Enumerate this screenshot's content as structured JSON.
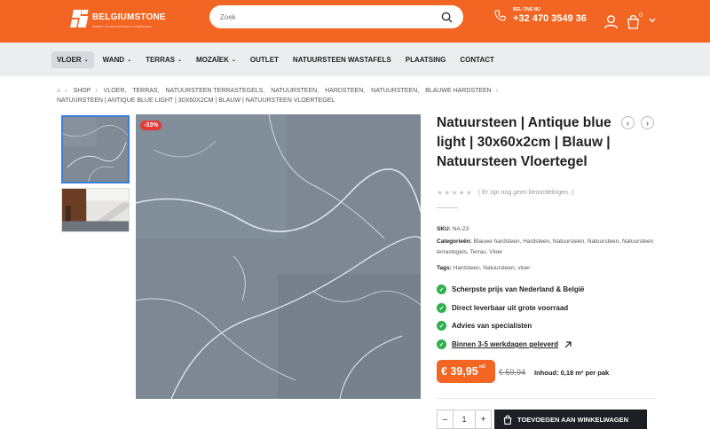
{
  "header": {
    "logo_name": "BELGIUMSTONE",
    "logo_tagline": "EXPERTS IN NATUURSTEEN & VLOERTEGELS",
    "search_placeholder": "Zoek",
    "call_label": "BEL ONS NU",
    "phone": "+32 470 3549 36",
    "cart_count": "0",
    "brand_color": "#f26522"
  },
  "nav": {
    "items": [
      {
        "label": "VLOER",
        "dropdown": true
      },
      {
        "label": "WAND",
        "dropdown": true
      },
      {
        "label": "TERRAS",
        "dropdown": true
      },
      {
        "label": "MOZAÏEK",
        "dropdown": true
      },
      {
        "label": "OUTLET",
        "dropdown": false
      },
      {
        "label": "NATUURSTEEN WASTAFELS",
        "dropdown": false
      },
      {
        "label": "PLAATSING",
        "dropdown": false
      },
      {
        "label": "CONTACT",
        "dropdown": false
      }
    ]
  },
  "breadcrumb": {
    "items": [
      "SHOP",
      "VLOER,",
      "TERRAS,",
      "NATUURSTEEN TERRASTEGELS,",
      "NATUURSTEEN,",
      "HARDSTEEN,",
      "NATUURSTEEN,",
      "BLAUWE HARDSTEEN"
    ],
    "current": "NATUURSTEEN | ANTIQUE BLUE LIGHT | 30X60X2CM | BLAUW | NATUURSTEEN VLOERTEGEL"
  },
  "product": {
    "discount_badge": "-33%",
    "title": "Natuursteen | Antique blue light | 30x60x2cm | Blauw | Natuursteen Vloertegel",
    "rating_text": "( Er zijn nog geen beoordelingen. )",
    "sku_label": "SKU:",
    "sku": "NA-23",
    "categories_label": "Categorieën:",
    "categories": "Blauwe hardsteen, Hardsteen, Natuursteen, Natuursteen, Natuursteen terrastegels, Terras, Vloer",
    "tags_label": "Tags:",
    "tags": "Hardsteen, Natuursteen, vloer",
    "usps": [
      "Scherpste prijs van Nederland & België",
      "Direct leverbaar uit grote voorraad",
      "Advies van specialisten",
      "Binnen 3-5 werkdagen geleverd"
    ],
    "price": "€ 39,95",
    "price_unit": "m2",
    "old_price": "€ 59,94",
    "content": "Inhoud: 0,18 m² per pak",
    "quantity": "1",
    "add_to_cart": "TOEVOEGEN AAN WINKELWAGEN",
    "check_color": "#2eb04d"
  }
}
